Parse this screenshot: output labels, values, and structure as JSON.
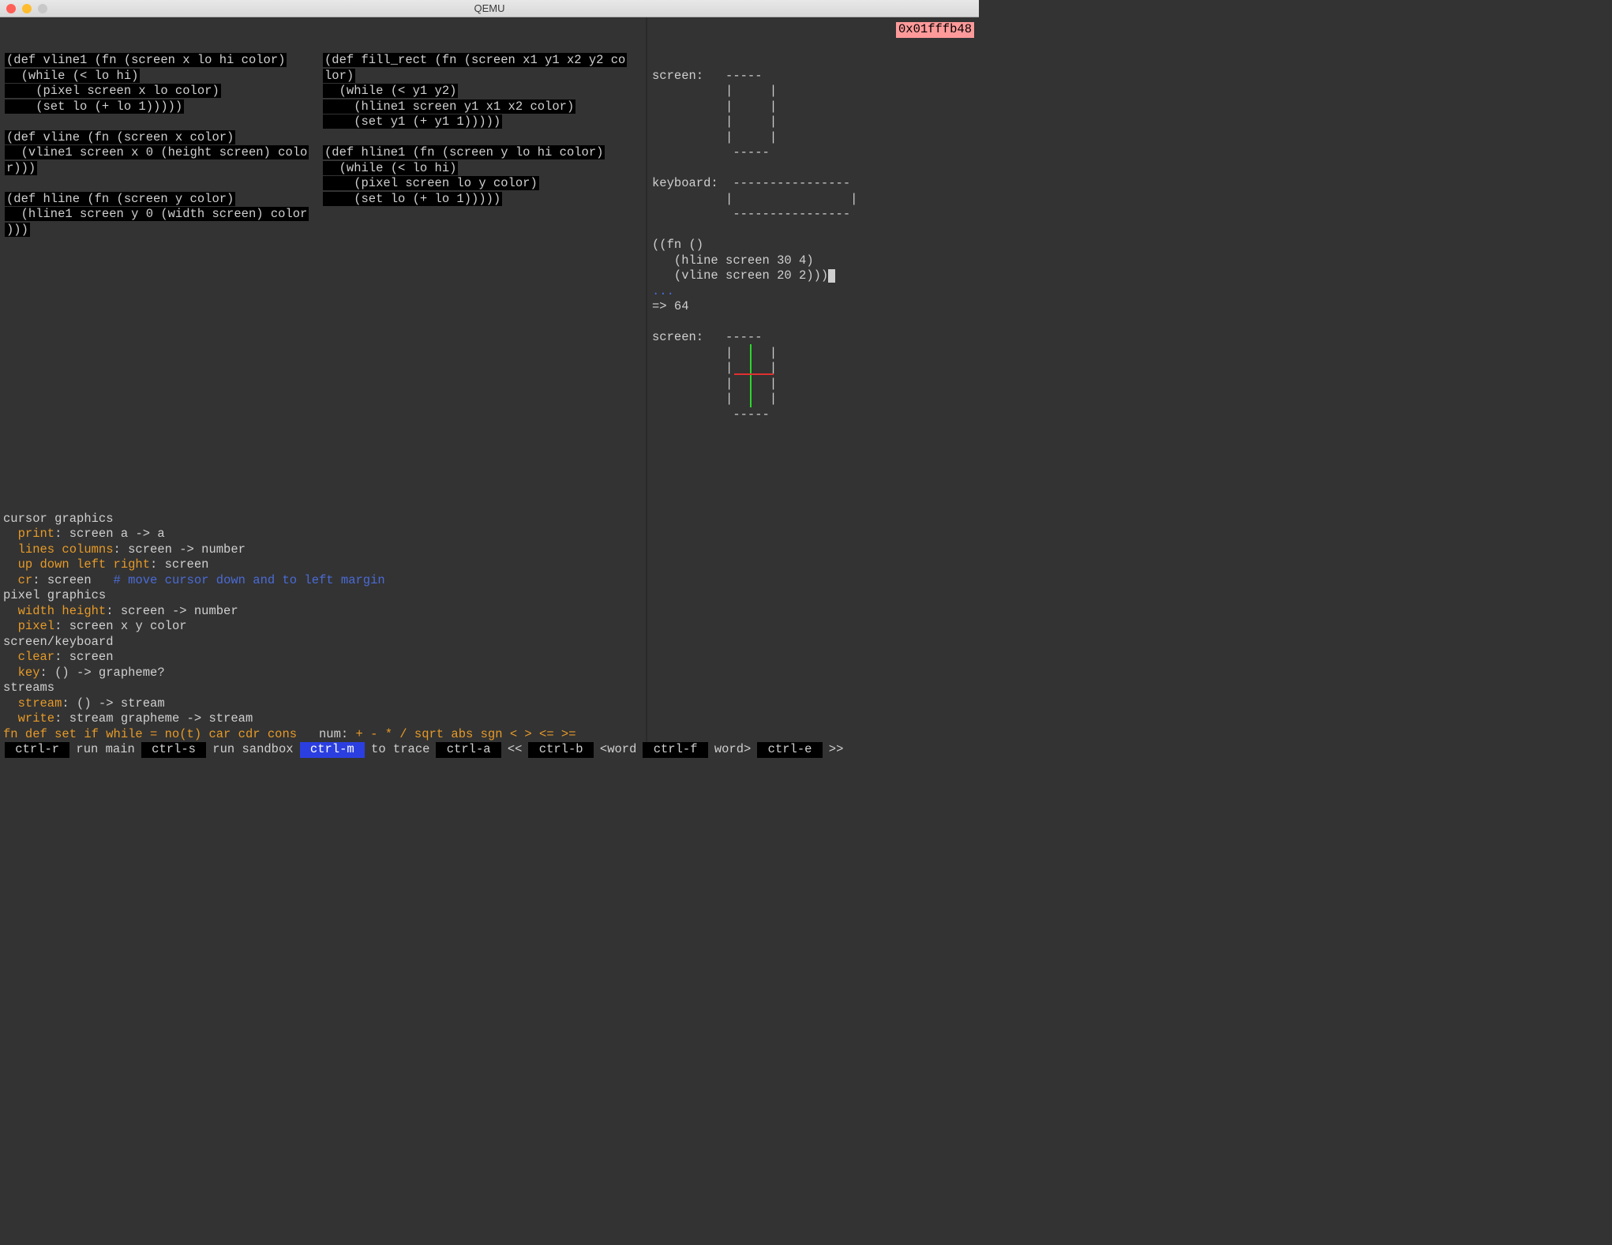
{
  "window": {
    "title": "QEMU"
  },
  "memory_address": "0x01fffb48",
  "editor": {
    "col1": [
      "(def vline1 (fn (screen x lo hi color)",
      "  (while (< lo hi)",
      "    (pixel screen x lo color)",
      "    (set lo (+ lo 1)))))",
      "",
      "(def vline (fn (screen x color)",
      "  (vline1 screen x 0 (height screen) colo",
      "r)))",
      "",
      "(def hline (fn (screen y color)",
      "  (hline1 screen y 0 (width screen) color",
      ")))"
    ],
    "col2": [
      "(def fill_rect (fn (screen x1 y1 x2 y2 co",
      "lor)",
      "  (while (< y1 y2)",
      "    (hline1 screen y1 x1 x2 color)",
      "    (set y1 (+ y1 1)))))",
      "",
      "(def hline1 (fn (screen y lo hi color)",
      "  (while (< lo hi)",
      "    (pixel screen lo y color)",
      "    (set lo (+ lo 1)))))"
    ]
  },
  "help": {
    "sections": [
      {
        "title": "cursor graphics",
        "items": [
          {
            "k": "print",
            "sig": ": screen a -> a"
          },
          {
            "k": "lines columns",
            "sig": ": screen -> number"
          },
          {
            "k": "up down left right",
            "sig": ": screen"
          },
          {
            "k": "cr",
            "sig": ": screen   ",
            "comment": "# move cursor down and to left margin"
          }
        ]
      },
      {
        "title": "pixel graphics",
        "items": [
          {
            "k": "width height",
            "sig": ": screen -> number"
          },
          {
            "k": "pixel",
            "sig": ": screen x y color"
          }
        ]
      },
      {
        "title": "screen/keyboard",
        "items": [
          {
            "k": "clear",
            "sig": ": screen"
          },
          {
            "k": "key",
            "sig": ": () -> grapheme?"
          }
        ]
      },
      {
        "title": "streams",
        "items": [
          {
            "k": "stream",
            "sig": ": () -> stream"
          },
          {
            "k": "write",
            "sig": ": stream grapheme -> stream"
          }
        ]
      }
    ],
    "fn_line_prefix": "fn def set if while = no(t) car cdr cons",
    "fn_line_num_label": "num:",
    "fn_line_ops": " + - * / sqrt abs sgn < > <= >="
  },
  "sandbox": {
    "screen1_label": "screen:",
    "screen1": [
      "           -----",
      "          |     |",
      "          |     |",
      "          |     |",
      "          |     |",
      "           -----"
    ],
    "keyboard_label": "keyboard:",
    "keyboard": [
      "           ----------------",
      "          |                |",
      "           ----------------"
    ],
    "repl_input": [
      "((fn ()",
      "   (hline screen 30 4)",
      "   (vline screen 20 2)))"
    ],
    "dots": "...",
    "result": "=> 64",
    "screen2_label": "screen:",
    "screen2": [
      "           -----",
      "          |     |",
      "          |     |",
      "          |     |",
      "          |     |",
      "           -----"
    ]
  },
  "keybar": {
    "items": [
      {
        "key": "ctrl-r",
        "label": "run main"
      },
      {
        "key": "ctrl-s",
        "label": "run sandbox"
      },
      {
        "key": "ctrl-m",
        "label": "to trace",
        "active": true
      },
      {
        "key": "ctrl-a",
        "label": "<<"
      },
      {
        "key": "ctrl-b",
        "label": "<word"
      },
      {
        "key": "ctrl-f",
        "label": "word>"
      },
      {
        "key": "ctrl-e",
        "label": ">>"
      }
    ]
  }
}
